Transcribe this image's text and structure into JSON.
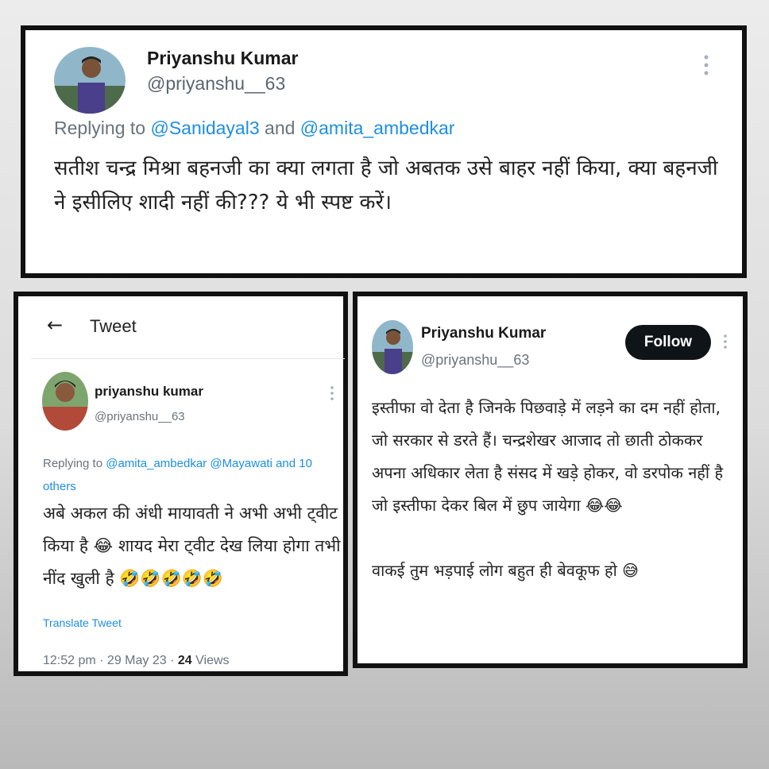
{
  "top_tweet": {
    "name": "Priyanshu Kumar",
    "handle": "@priyanshu__63",
    "replying_prefix": "Replying to",
    "mention_1": "@Sanidayal3",
    "replying_joiner": "and",
    "mention_2": "@amita_ambedkar",
    "body": "सतीश चन्द्र मिश्रा बहनजी का क्या लगता है जो अबतक उसे बाहर नहीं किया, क्या बहनजी ने इसीलिए शादी नहीं की??? ये भी स्पष्ट करें।"
  },
  "left_tweet": {
    "back_icon": "←",
    "page_title": "Tweet",
    "name": "priyanshu kumar",
    "handle": "@priyanshu__63",
    "replying_prefix": "Replying to",
    "mentions": "@amita_ambedkar @Mayawati and 10 others",
    "body": "अबे अकल की अंधी मायावती ने अभी अभी ट्वीट किया है 😂 शायद मेरा ट्वीट देख लिया होगा तभी नींद खुली है 🤣🤣🤣🤣🤣",
    "translate": "Translate Tweet",
    "meta_time": "12:52 pm · 29 May 23 ·",
    "views_count": "24",
    "views_label": "Views"
  },
  "right_tweet": {
    "name": "Priyanshu Kumar",
    "handle": "@priyanshu__63",
    "follow_label": "Follow",
    "body": "इस्तीफा वो देता है जिनके पिछवाड़े में लड़ने का दम नहीं होता, जो सरकार से डरते हैं। चन्द्रशेखर आजाद तो छाती ठोककर अपना अधिकार लेता है संसद में खड़े होकर, वो डरपोक नहीं है जो इस्तीफा देकर बिल में छुप जायेगा 😂😂\n\nवाकई तुम भड़पाई लोग बहुत ही बेवकूफ हो 😅"
  },
  "colors": {
    "mention": "#1d8fe0",
    "follow_bg": "#0f1419",
    "border": "#111111"
  },
  "icons": [
    "avatar",
    "more-dots-icon",
    "back-arrow-icon"
  ]
}
